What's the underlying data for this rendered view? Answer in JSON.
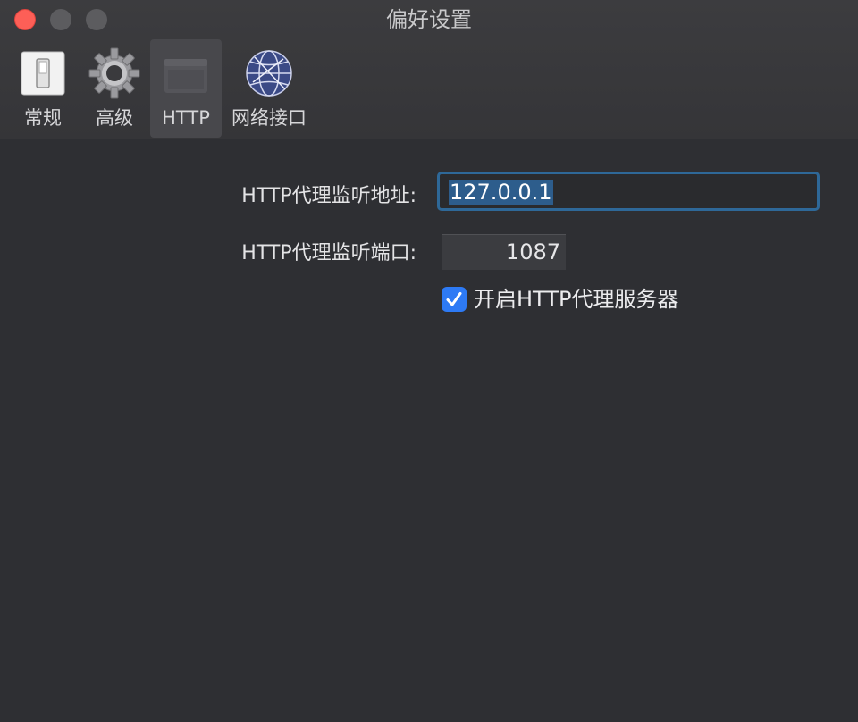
{
  "window": {
    "title": "偏好设置"
  },
  "toolbar": {
    "items": [
      {
        "label": "常规",
        "icon": "switch-icon"
      },
      {
        "label": "高级",
        "icon": "gear-icon"
      },
      {
        "label": "HTTP",
        "icon": "http-icon"
      },
      {
        "label": "网络接口",
        "icon": "network-globe-icon"
      }
    ],
    "selected": "HTTP"
  },
  "http": {
    "listen_address_label": "HTTP代理监听地址:",
    "listen_address_value": "127.0.0.1",
    "listen_port_label": "HTTP代理监听端口:",
    "listen_port_value": "1087",
    "enable_label": "开启HTTP代理服务器",
    "enable_checked": true
  },
  "colors": {
    "accent": "#2d7af5",
    "focus_ring": "#2e6898",
    "close_button": "#fd5f57",
    "background": "#2e2f33"
  }
}
